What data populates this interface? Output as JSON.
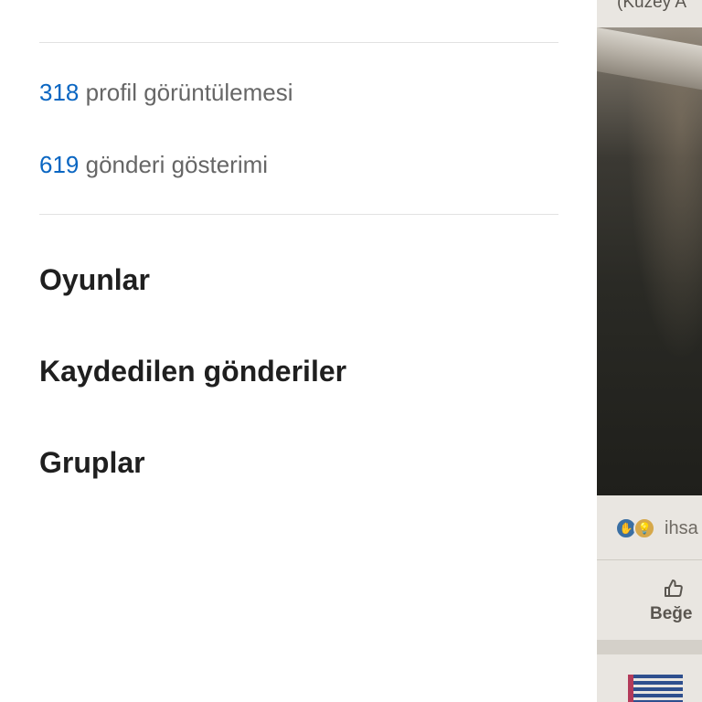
{
  "stats": {
    "profile_views": {
      "count": "318",
      "label": "profil görüntülemesi"
    },
    "post_impressions": {
      "count": "619",
      "label": "gönderi gösterimi"
    }
  },
  "menu": {
    "items": [
      {
        "label": "Oyunlar"
      },
      {
        "label": "Kaydedilen gönderiler"
      },
      {
        "label": "Gruplar"
      }
    ]
  },
  "feed": {
    "caption": "(Kuzey A",
    "reactor_name": "ihsa",
    "like_label": "Beğe"
  },
  "colors": {
    "accent": "#0a66c2",
    "text_primary": "#1f1f1f",
    "text_secondary": "#666666",
    "divider": "#e2e2e2"
  }
}
